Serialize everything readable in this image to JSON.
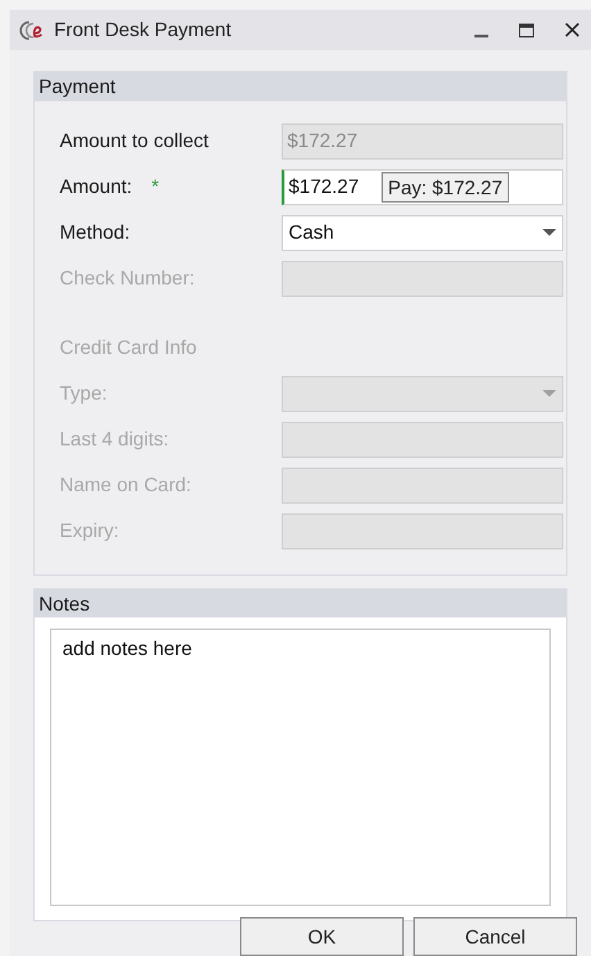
{
  "window": {
    "title": "Front Desk Payment"
  },
  "payment": {
    "title": "Payment",
    "rows": [
      {
        "kind": "text",
        "label": "Amount to collect",
        "value": "$172.27",
        "disabled": false,
        "readonly": true
      },
      {
        "kind": "text",
        "label": "Amount:",
        "required_mark": "*",
        "value": "$172.27",
        "disabled": false,
        "focused": true,
        "suggestion": "Pay: $172.27"
      },
      {
        "kind": "select",
        "label": "Method:",
        "value": "Cash",
        "disabled": false
      },
      {
        "kind": "text",
        "label": "Check Number:",
        "disabled": true
      },
      {
        "kind": "heading",
        "label": "Credit Card Info",
        "disabled": true
      },
      {
        "kind": "select",
        "label": "Type:",
        "disabled": true
      },
      {
        "kind": "text",
        "label": "Last 4 digits:",
        "disabled": true
      },
      {
        "kind": "text",
        "label": "Name on Card:",
        "disabled": true
      },
      {
        "kind": "text",
        "label": "Expiry:",
        "disabled": true
      }
    ]
  },
  "notes": {
    "title": "Notes",
    "value": "add notes here"
  },
  "buttons": [
    "OK",
    "Cancel"
  ]
}
